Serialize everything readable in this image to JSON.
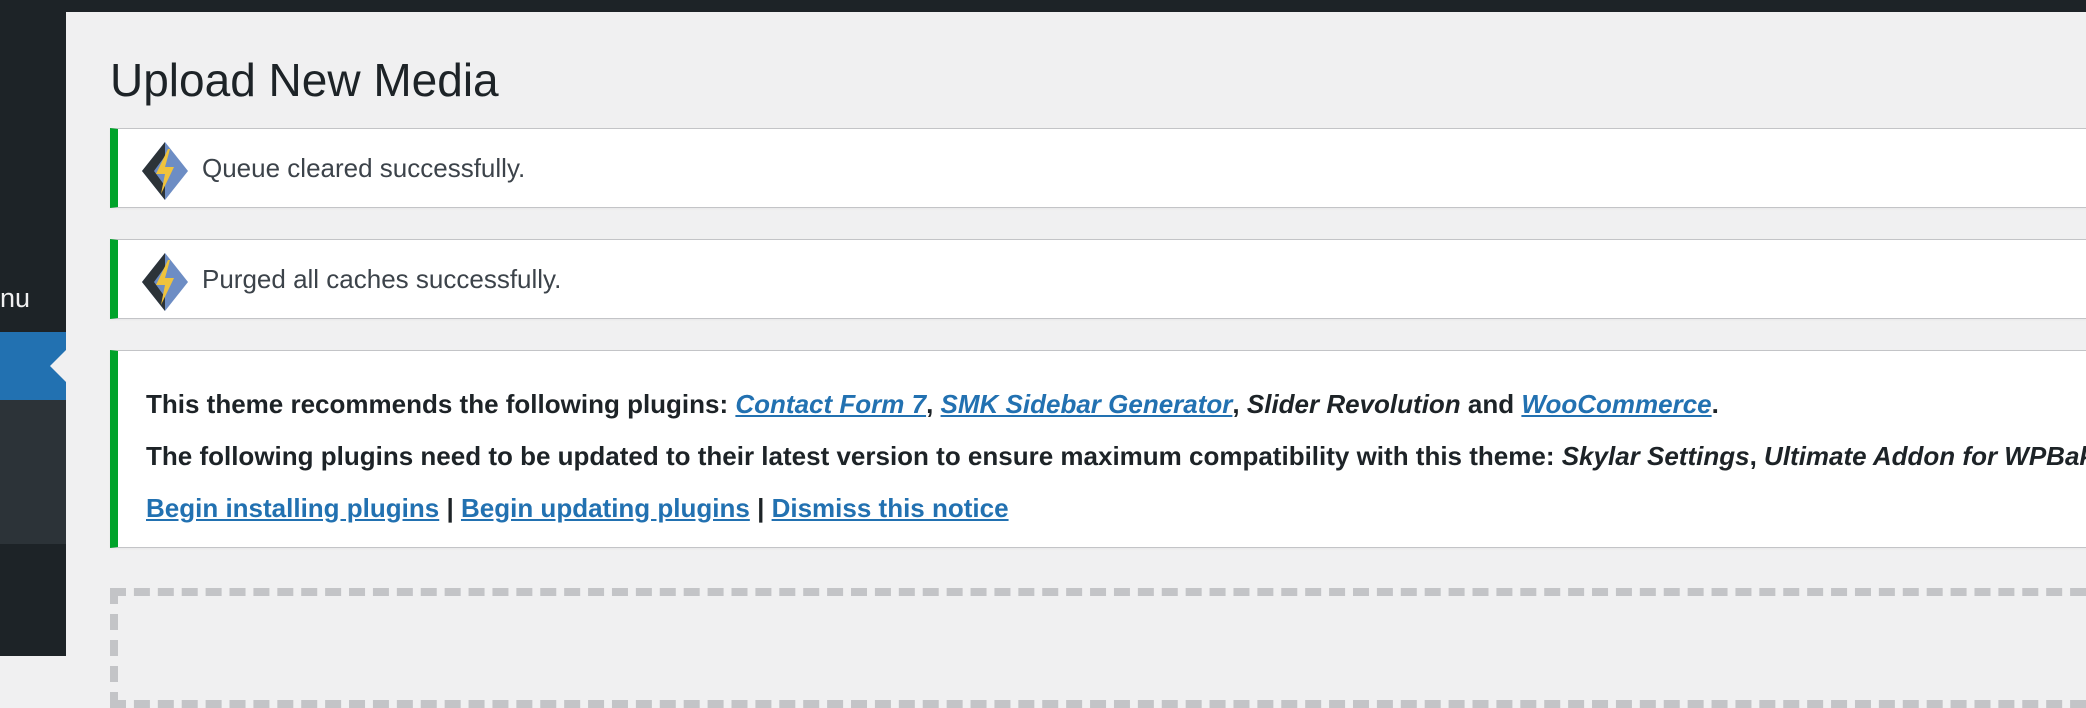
{
  "admin": {
    "sidebar_fragment": "nu"
  },
  "page": {
    "title": "Upload New Media"
  },
  "notices": [
    {
      "text": "Queue cleared successfully.",
      "icon": "litespeed-icon"
    },
    {
      "text": "Purged all caches successfully.",
      "icon": "litespeed-icon"
    }
  ],
  "plugin_notice": {
    "line1_prefix": "This theme recommends the following plugins:",
    "recommended": [
      "Contact Form 7",
      "SMK Sidebar Generator",
      "Slider Revolution",
      "WooCommerce"
    ],
    "line1_and": "and",
    "comma": ",",
    "period": ".",
    "line2_prefix": "The following plugins need to be updated to their latest version to ensure maximum compatibility with this theme:",
    "update_plugins": [
      "Skylar Settings",
      "Ultimate Addon for WPBakery"
    ],
    "pipe": "|",
    "actions": {
      "install": "Begin installing plugins",
      "update": "Begin updating plugins",
      "dismiss": "Dismiss this notice"
    }
  },
  "colors": {
    "admin_bar": "#1d2327",
    "active_menu": "#2271b1",
    "success_border": "#00a32a",
    "link": "#2271b1"
  }
}
